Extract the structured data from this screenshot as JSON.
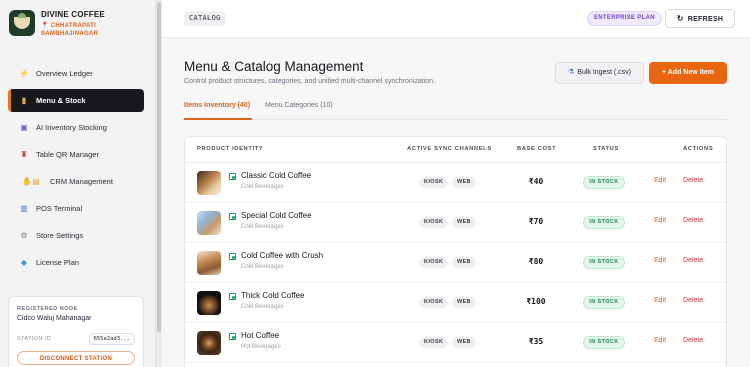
{
  "brand": {
    "name": "DIVINE COFFEE",
    "location_line1": "CHHATRAPATI",
    "location_line2": "SAMBHAJINAGAR"
  },
  "sidebar": {
    "items": [
      {
        "label": "Overview Ledger",
        "icon": "lightning-icon"
      },
      {
        "label": "Menu & Stock",
        "icon": "menu-book-icon",
        "active": true
      },
      {
        "label": "AI Inventory Stocking",
        "icon": "ai-inventory-icon"
      },
      {
        "label": "Table QR Manager",
        "icon": "waiter-icon"
      },
      {
        "label": "CRM Management",
        "icon": "crm-icon"
      },
      {
        "label": "POS Terminal",
        "icon": "chart-icon"
      },
      {
        "label": "Store Settings",
        "icon": "gear-icon"
      },
      {
        "label": "License Plan",
        "icon": "diamond-icon"
      }
    ],
    "node": {
      "label": "REGISTERED NODE",
      "name": "Cidco Waluj Mahanagar",
      "station_label": "STATION ID",
      "station_id": "655e2ad3...",
      "disconnect_label": "DISCONNECT STATION"
    }
  },
  "header": {
    "breadcrumb": "CATALOG",
    "plan": "ENTERPRISE PLAN",
    "refresh_label": "REFRESH"
  },
  "main": {
    "title": "Menu & Catalog Management",
    "subtitle": "Control product structures, categories, and unified multi-channel synchronization.",
    "bulk_label": "Bulk Ingest (.csv)",
    "add_label": "+ Add New Item",
    "tabs": [
      {
        "label": "Items Inventory (40)"
      },
      {
        "label": "Menu Categories (10)"
      }
    ],
    "columns": {
      "product": "PRODUCT IDENTITY",
      "channels": "ACTIVE SYNC CHANNELS",
      "cost": "BASE COST",
      "status": "STATUS",
      "actions": "ACTIONS"
    },
    "rows": [
      {
        "name": "Classic Cold Coffee",
        "category": "Cold Beverages",
        "channels": [
          "KIOSK",
          "WEB"
        ],
        "price": "₹40",
        "status": "IN STOCK",
        "edit": "Edit",
        "delete": "Delete"
      },
      {
        "name": "Special Cold Coffee",
        "category": "Cold Beverages",
        "channels": [
          "KIOSK",
          "WEB"
        ],
        "price": "₹70",
        "status": "IN STOCK",
        "edit": "Edit",
        "delete": "Delete"
      },
      {
        "name": "Cold Coffee with Crush",
        "category": "Cold Beverages",
        "channels": [
          "KIOSK",
          "WEB"
        ],
        "price": "₹80",
        "status": "IN STOCK",
        "edit": "Edit",
        "delete": "Delete"
      },
      {
        "name": "Thick Cold Coffee",
        "category": "Cold Beverages",
        "channels": [
          "KIOSK",
          "WEB"
        ],
        "price": "₹100",
        "status": "IN STOCK",
        "edit": "Edit",
        "delete": "Delete"
      },
      {
        "name": "Hot Coffee",
        "category": "Hot Beverages",
        "channels": [
          "KIOSK",
          "WEB"
        ],
        "price": "₹35",
        "status": "IN STOCK",
        "edit": "Edit",
        "delete": "Delete"
      }
    ]
  },
  "colors": {
    "accent": "#e8660f",
    "status_green": "#1d8a4a",
    "delete_red": "#d63a4a",
    "active_nav": "#17181c"
  }
}
